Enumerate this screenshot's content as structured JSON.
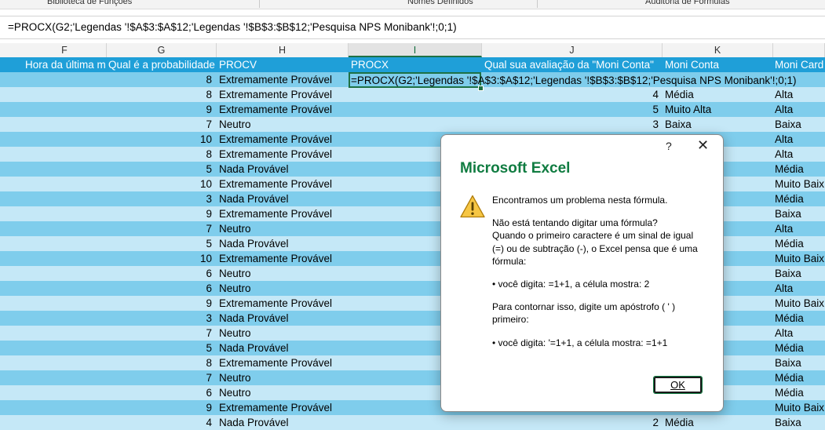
{
  "ribbon": {
    "group_labels": [
      "Biblioteca de Funções",
      "Nomes Definidos",
      "Auditoria de Fórmulas"
    ]
  },
  "formula_bar": {
    "content": "=PROCX(G2;'Legendas '!$A$3:$A$12;'Legendas '!$B$3:$B$12;'Pesquisa NPS Monibank'!;0;1)"
  },
  "columns": [
    "F",
    "G",
    "H",
    "I",
    "J",
    "K",
    ""
  ],
  "active_column": "I",
  "sheet": {
    "header_row": [
      "Hora da última m",
      "Qual é a probabilidade",
      "PROCV",
      "PROCX",
      "Qual sua avaliação da \"Moni Conta\"",
      "Moni Conta",
      "Moni Card"
    ],
    "editing_cell": "=PROCX(G2;'Legendas '!$A$3:$A$12;'Legendas '!$B$3:$B$12;'Pesquisa NPS Monibank'!;0;1)",
    "rows": [
      {
        "g": "8",
        "h": "Extremamente Provável",
        "j": "",
        "k": "",
        "l": ""
      },
      {
        "g": "8",
        "h": "Extremamente Provável",
        "j": "4",
        "k": "Média",
        "l": "Alta"
      },
      {
        "g": "9",
        "h": "Extremamente Provável",
        "j": "5",
        "k": "Muito Alta",
        "l": "Alta"
      },
      {
        "g": "7",
        "h": "Neutro",
        "j": "3",
        "k": "Baixa",
        "l": "Baixa"
      },
      {
        "g": "10",
        "h": "Extremamente Provável",
        "j": "",
        "k": "",
        "l": "Alta"
      },
      {
        "g": "8",
        "h": "Extremamente Provável",
        "j": "",
        "k": "",
        "l": "Alta"
      },
      {
        "g": "5",
        "h": "Nada Provável",
        "j": "",
        "k": "",
        "l": "Média"
      },
      {
        "g": "10",
        "h": "Extremamente Provável",
        "j": "",
        "k": "",
        "l": "Muito Baix"
      },
      {
        "g": "3",
        "h": "Nada Provável",
        "j": "",
        "k": "",
        "l": "Média"
      },
      {
        "g": "9",
        "h": "Extremamente Provável",
        "j": "",
        "k": "",
        "l": "Baixa"
      },
      {
        "g": "7",
        "h": "Neutro",
        "j": "",
        "k": "",
        "l": "Alta"
      },
      {
        "g": "5",
        "h": "Nada Provável",
        "j": "",
        "k": "",
        "l": "Média"
      },
      {
        "g": "10",
        "h": "Extremamente Provável",
        "j": "",
        "k": "",
        "l": "Muito Baix"
      },
      {
        "g": "6",
        "h": "Neutro",
        "j": "",
        "k": "",
        "l": "Baixa"
      },
      {
        "g": "6",
        "h": "Neutro",
        "j": "",
        "k": "",
        "l": "Alta"
      },
      {
        "g": "9",
        "h": "Extremamente Provável",
        "j": "",
        "k": "",
        "l": "Muito Baix"
      },
      {
        "g": "3",
        "h": "Nada Provável",
        "j": "",
        "k": "",
        "l": "Média"
      },
      {
        "g": "7",
        "h": "Neutro",
        "j": "",
        "k": "",
        "l": "Alta"
      },
      {
        "g": "5",
        "h": "Nada Provável",
        "j": "",
        "k": "",
        "l": "Média"
      },
      {
        "g": "8",
        "h": "Extremamente Provável",
        "j": "",
        "k": "",
        "l": "Baixa"
      },
      {
        "g": "7",
        "h": "Neutro",
        "j": "",
        "k": "",
        "l": "Média"
      },
      {
        "g": "6",
        "h": "Neutro",
        "j": "",
        "k": "",
        "l": "Média"
      },
      {
        "g": "9",
        "h": "Extremamente Provável",
        "j": "",
        "k": "",
        "l": "Muito Baix"
      },
      {
        "g": "4",
        "h": "Nada Provável",
        "j": "2",
        "k": "Média",
        "l": "Baixa"
      }
    ]
  },
  "dialog": {
    "title": "Microsoft Excel",
    "help_glyph": "?",
    "close_glyph": "✕",
    "icon": "warning-icon",
    "message_lines": [
      "Encontramos um problema nesta fórmula.",
      "",
      "Não está tentando digitar uma fórmula?",
      "Quando o primeiro caractere é um sinal de igual",
      "(=) ou de subtração (-), o Excel pensa que é uma",
      "fórmula:",
      "",
      "• você digita:   =1+1, a célula mostra:   2",
      "",
      "Para contornar isso, digite um apóstrofo ( ' )",
      "primeiro:",
      "",
      "• você digita:   '=1+1, a célula mostra:   =1+1"
    ],
    "ok_label": "OK"
  },
  "colors": {
    "header_row": "#1f9fd8",
    "band_dark": "#7fcdec",
    "band_light": "#c5e8f7",
    "excel_green": "#107c41",
    "warning_yellow": "#f6c644"
  }
}
